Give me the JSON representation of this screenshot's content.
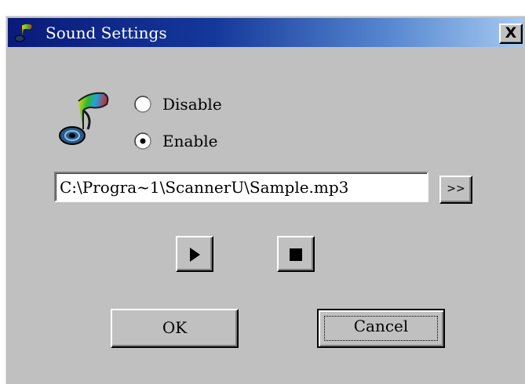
{
  "window": {
    "title": "Sound Settings",
    "close_label": "X",
    "title_icon": "music-note-icon"
  },
  "sound_icon": "music-note-icon",
  "mode": {
    "options": [
      {
        "label": "Disable",
        "selected": false
      },
      {
        "label": "Enable",
        "selected": true
      }
    ]
  },
  "file": {
    "path": "C:\\Progra~1\\ScannerU\\Sample.mp3",
    "browse_label": ">>"
  },
  "playback": {
    "play_icon": "play-icon",
    "stop_icon": "stop-icon"
  },
  "buttons": {
    "ok_label": "OK",
    "cancel_label": "Cancel",
    "focused": "Cancel"
  },
  "colors": {
    "titlebar_start": "#0a1a7a",
    "titlebar_end": "#a6caf0",
    "dialog_face": "#c0c0c0"
  }
}
